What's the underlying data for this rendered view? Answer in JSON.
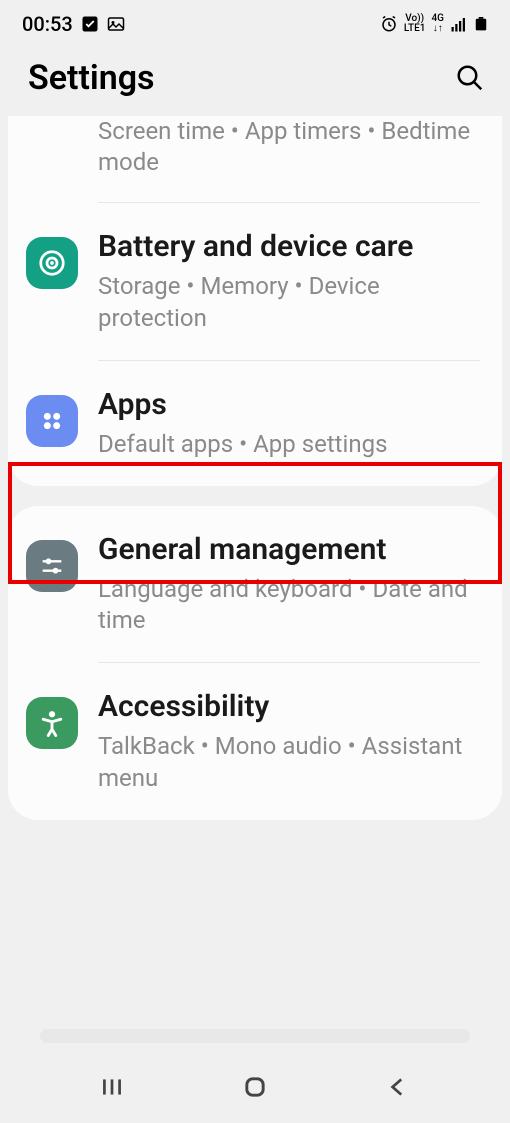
{
  "status": {
    "time": "00:53",
    "network_label": "LTE1",
    "network_type": "4G",
    "volte": "Vo))"
  },
  "header": {
    "title": "Settings"
  },
  "groups": [
    {
      "items": [
        {
          "id": "screen-time",
          "sub": "Screen time  •  App timers  •  Bedtime mode"
        },
        {
          "id": "battery",
          "title": "Battery and device care",
          "sub": "Storage  •  Memory  •  Device protection",
          "icon": "battery-care-icon",
          "icon_bg": "icon-teal"
        },
        {
          "id": "apps",
          "title": "Apps",
          "sub": "Default apps  •  App settings",
          "icon": "apps-icon",
          "icon_bg": "icon-blue",
          "highlighted": true
        }
      ]
    },
    {
      "items": [
        {
          "id": "general",
          "title": "General management",
          "sub": "Language and keyboard  •  Date and time",
          "icon": "sliders-icon",
          "icon_bg": "icon-slate"
        },
        {
          "id": "accessibility",
          "title": "Accessibility",
          "sub": "TalkBack  •  Mono audio  •  Assistant menu",
          "icon": "accessibility-icon",
          "icon_bg": "icon-green"
        }
      ]
    }
  ]
}
